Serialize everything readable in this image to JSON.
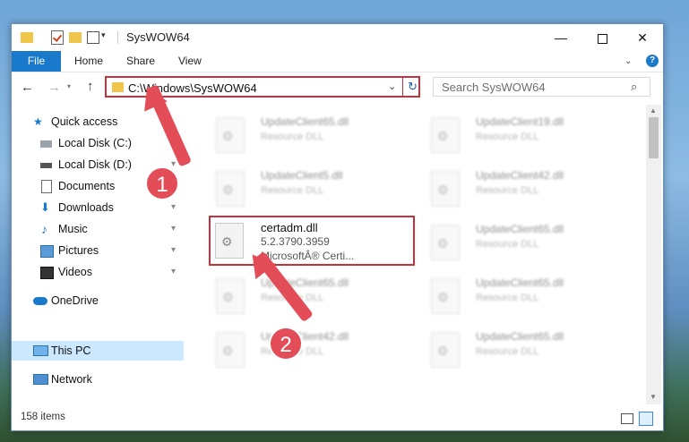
{
  "window": {
    "title": "SysWOW64",
    "controls": {
      "minimize": "—",
      "maximize": "",
      "close": "✕"
    },
    "qa_dropdown": "▾"
  },
  "ribbon": {
    "tabs": [
      "File",
      "Home",
      "Share",
      "View"
    ],
    "collapse_icon": "⌄",
    "help_icon": "?"
  },
  "nav": {
    "back": "←",
    "forward": "→",
    "recent_dropdown": "▾",
    "up": "↑",
    "address": "C:\\Windows\\SysWOW64",
    "address_dropdown": "⌄",
    "refresh": "↻",
    "search_placeholder": "Search SysWOW64",
    "search_icon": "⌕"
  },
  "sidebar": {
    "items": [
      {
        "label": "Quick access",
        "icon": "star-icon",
        "pinned": false
      },
      {
        "label": "Local Disk (C:)",
        "icon": "drive-icon",
        "pinned": true
      },
      {
        "label": "Local Disk (D:)",
        "icon": "drive-icon",
        "pinned": true
      },
      {
        "label": "Documents",
        "icon": "document-icon",
        "pinned": true
      },
      {
        "label": "Downloads",
        "icon": "download-icon",
        "pinned": true
      },
      {
        "label": "Music",
        "icon": "music-icon",
        "pinned": true
      },
      {
        "label": "Pictures",
        "icon": "picture-icon",
        "pinned": true
      },
      {
        "label": "Videos",
        "icon": "video-icon",
        "pinned": true
      },
      {
        "label": "OneDrive",
        "icon": "cloud-icon",
        "pinned": false
      },
      {
        "label": "This PC",
        "icon": "computer-icon",
        "pinned": false,
        "selected": true
      },
      {
        "label": "Network",
        "icon": "network-icon",
        "pinned": false
      }
    ],
    "pin_glyph": "📌"
  },
  "files": [
    {
      "name": "UpdateClient65.dll",
      "desc": "Resource DLL"
    },
    {
      "name": "UpdateClient19.dll",
      "desc": "Resource DLL"
    },
    {
      "name": "UpdateClient5.dll",
      "desc": "Resource DLL"
    },
    {
      "name": "UpdateClient42.dll",
      "desc": "Resource DLL"
    },
    {
      "name": "certadm.dll",
      "version": "5.2.3790.3959",
      "desc": "MicrosoftÂ® Certi...",
      "highlighted": true
    },
    {
      "name": "UpdateClient65.dll",
      "desc": "Resource DLL"
    },
    {
      "name": "UpdateClient65.dll",
      "desc": "Resource DLL"
    },
    {
      "name": "UpdateClient65.dll",
      "desc": "Resource DLL"
    },
    {
      "name": "UpdateClient42.dll",
      "desc": "Resource DLL"
    },
    {
      "name": "UpdateClient65.dll",
      "desc": "Resource DLL"
    }
  ],
  "status": {
    "item_count": "158 items"
  },
  "annotations": {
    "step1": "1",
    "step2": "2"
  },
  "colors": {
    "accent": "#1979ca",
    "highlight_border": "#c5323c",
    "annotation": "#e34d57",
    "selected_bg": "#cce8ff"
  }
}
